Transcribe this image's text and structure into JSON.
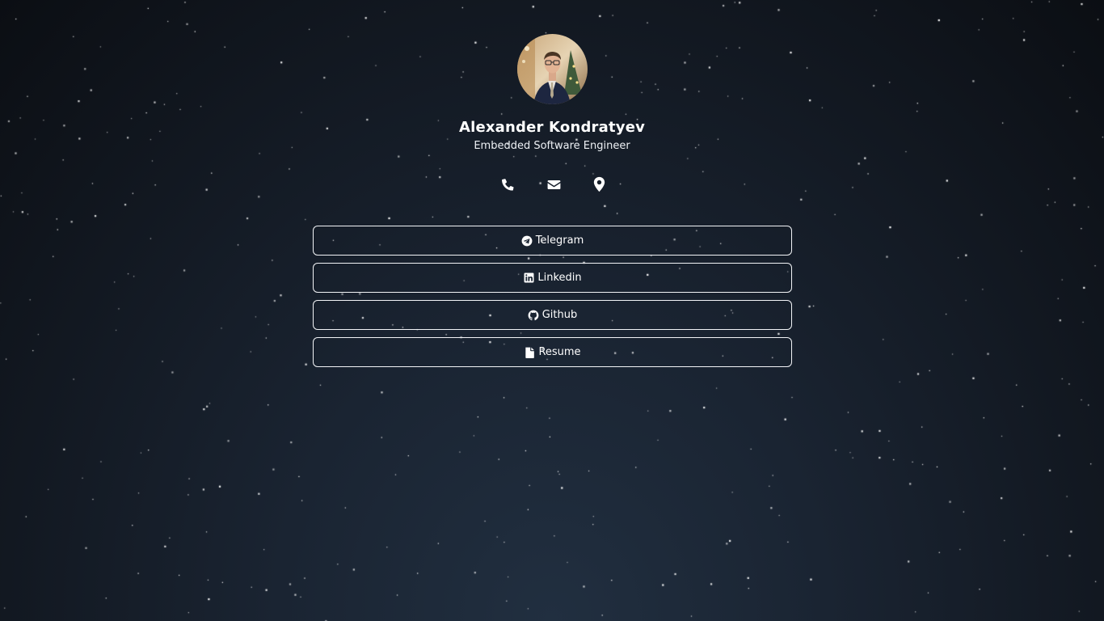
{
  "profile": {
    "name": "Alexander Kondratyev",
    "title": "Embedded Software Engineer",
    "avatar_icon": "profile-photo"
  },
  "contacts": [
    {
      "icon": "phone-icon"
    },
    {
      "icon": "envelope-icon"
    },
    {
      "icon": "map-marker-icon"
    }
  ],
  "links": [
    {
      "label": "Telegram",
      "icon": "telegram-icon"
    },
    {
      "label": "Linkedin",
      "icon": "linkedin-icon"
    },
    {
      "label": "Github",
      "icon": "github-icon"
    },
    {
      "label": "Resume",
      "icon": "file-icon"
    }
  ],
  "colors": {
    "background_center": "#212f40",
    "background_edge": "#0b0e13",
    "text": "#ffffff",
    "border": "#f2f4f7"
  }
}
